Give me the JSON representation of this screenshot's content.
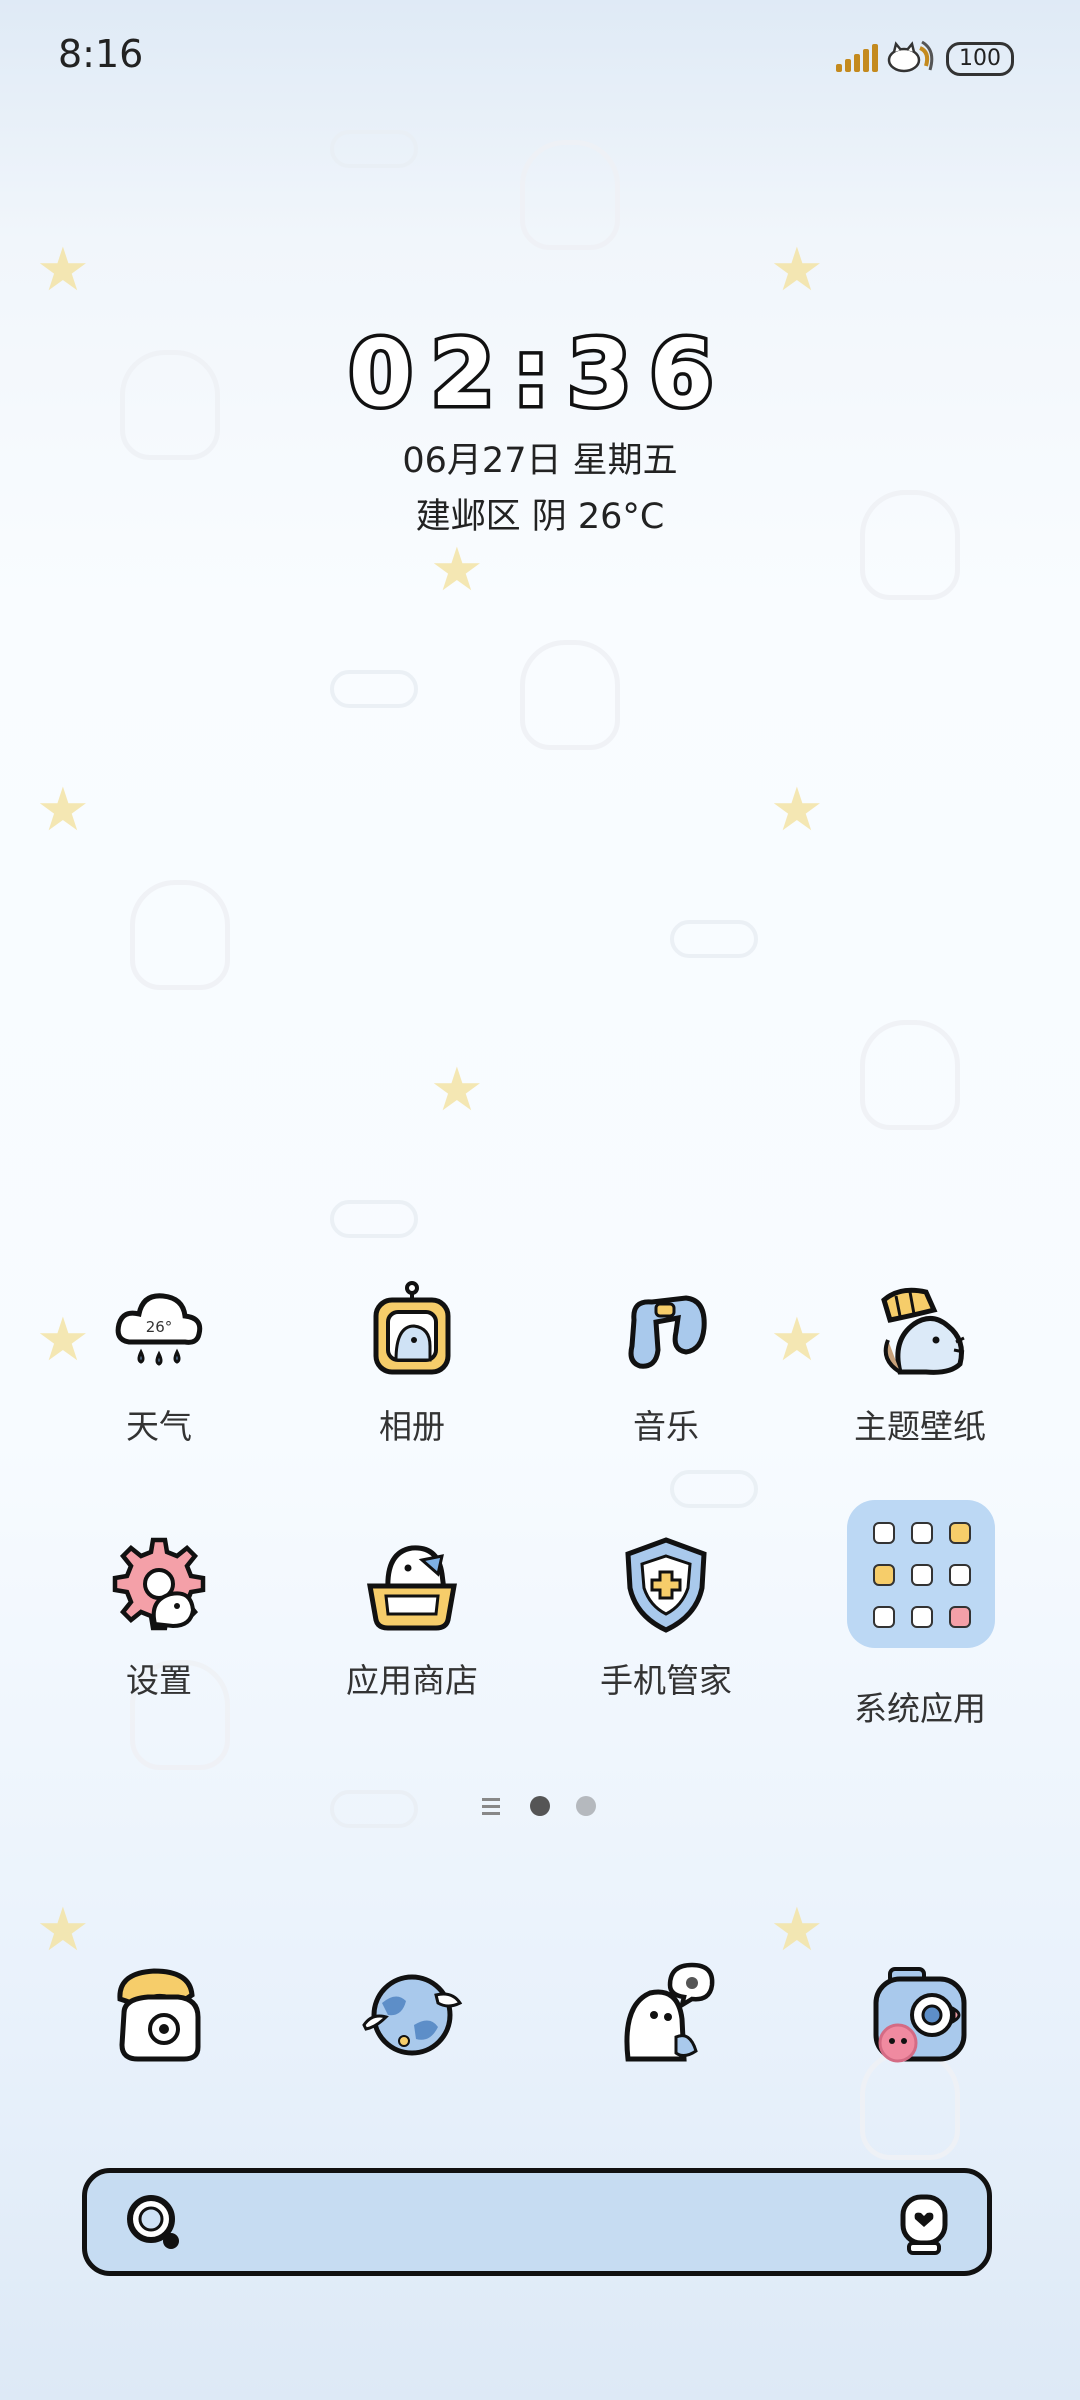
{
  "status_bar": {
    "time": "8:16",
    "battery": "100"
  },
  "lock_widget": {
    "clock": "02:36",
    "date": "06月27日 星期五",
    "weather": "建邺区 阴 26°C"
  },
  "apps": [
    {
      "label": "天气",
      "icon": "weather-cloud-icon"
    },
    {
      "label": "相册",
      "icon": "photo-frame-icon"
    },
    {
      "label": "音乐",
      "icon": "music-note-icon"
    },
    {
      "label": "主题壁纸",
      "icon": "theme-character-icon"
    },
    {
      "label": "设置",
      "icon": "gear-icon"
    },
    {
      "label": "应用商店",
      "icon": "store-basket-icon"
    },
    {
      "label": "手机管家",
      "icon": "shield-plus-icon"
    },
    {
      "label": "系统应用",
      "icon": "folder-icon"
    }
  ],
  "weather_icon_text": "26°",
  "page_indicator": {
    "pages": 2,
    "current": 1
  },
  "dock": [
    {
      "icon": "phone-icon"
    },
    {
      "icon": "browser-globe-icon"
    },
    {
      "icon": "messages-ghost-icon"
    },
    {
      "icon": "camera-icon"
    }
  ],
  "search": {
    "icon": "search-icon",
    "assistant_icon": "assistant-icon"
  },
  "colors": {
    "accent_blue": "#bcd8f4",
    "outline": "#111111",
    "battery_signal": "#c48a1e",
    "pink": "#f4a0a8",
    "yellow": "#f6cd6a"
  }
}
